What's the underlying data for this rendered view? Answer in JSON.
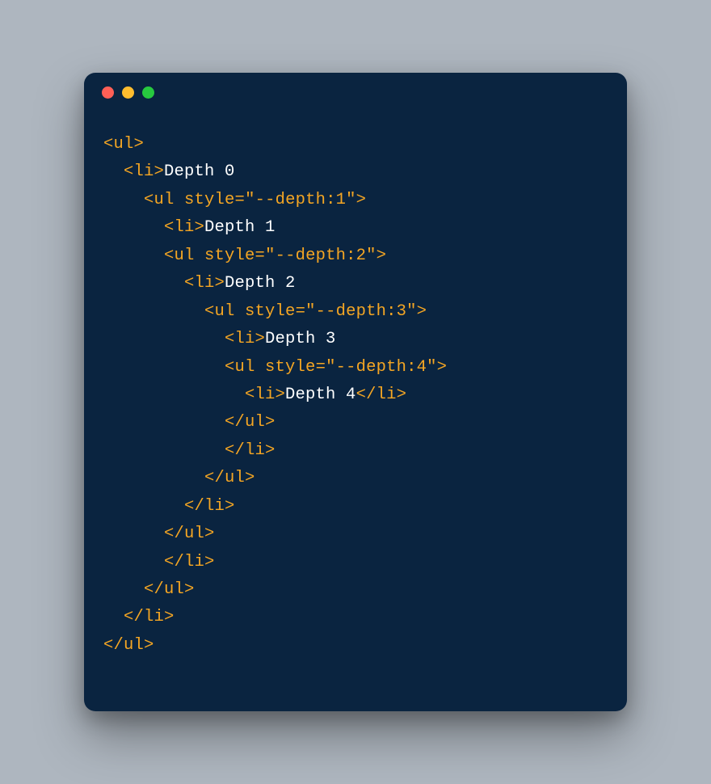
{
  "window": {
    "traffic_lights": {
      "close": "close",
      "minimize": "minimize",
      "maximize": "maximize"
    }
  },
  "code": {
    "lines": [
      {
        "indent": 0,
        "tokens": [
          {
            "c": "tag",
            "t": "<ul>"
          }
        ]
      },
      {
        "indent": 1,
        "tokens": [
          {
            "c": "tag",
            "t": "<li>"
          },
          {
            "c": "text",
            "t": "Depth 0"
          }
        ]
      },
      {
        "indent": 2,
        "tokens": [
          {
            "c": "tag",
            "t": "<ul "
          },
          {
            "c": "attr",
            "t": "style"
          },
          {
            "c": "tag",
            "t": "="
          },
          {
            "c": "str",
            "t": "\"--depth:1\""
          },
          {
            "c": "tag",
            "t": ">"
          }
        ]
      },
      {
        "indent": 3,
        "tokens": [
          {
            "c": "tag",
            "t": "<li>"
          },
          {
            "c": "text",
            "t": "Depth 1"
          }
        ]
      },
      {
        "indent": 3,
        "tokens": [
          {
            "c": "tag",
            "t": "<ul "
          },
          {
            "c": "attr",
            "t": "style"
          },
          {
            "c": "tag",
            "t": "="
          },
          {
            "c": "str",
            "t": "\"--depth:2\""
          },
          {
            "c": "tag",
            "t": ">"
          }
        ]
      },
      {
        "indent": 4,
        "tokens": [
          {
            "c": "tag",
            "t": "<li>"
          },
          {
            "c": "text",
            "t": "Depth 2"
          }
        ]
      },
      {
        "indent": 5,
        "tokens": [
          {
            "c": "tag",
            "t": "<ul "
          },
          {
            "c": "attr",
            "t": "style"
          },
          {
            "c": "tag",
            "t": "="
          },
          {
            "c": "str",
            "t": "\"--depth:3\""
          },
          {
            "c": "tag",
            "t": ">"
          }
        ]
      },
      {
        "indent": 6,
        "tokens": [
          {
            "c": "tag",
            "t": "<li>"
          },
          {
            "c": "text",
            "t": "Depth 3"
          }
        ]
      },
      {
        "indent": 6,
        "tokens": [
          {
            "c": "tag",
            "t": "<ul "
          },
          {
            "c": "attr",
            "t": "style"
          },
          {
            "c": "tag",
            "t": "="
          },
          {
            "c": "str",
            "t": "\"--depth:4\""
          },
          {
            "c": "tag",
            "t": ">"
          }
        ]
      },
      {
        "indent": 7,
        "tokens": [
          {
            "c": "tag",
            "t": "<li>"
          },
          {
            "c": "text",
            "t": "Depth 4"
          },
          {
            "c": "tag",
            "t": "</li>"
          }
        ]
      },
      {
        "indent": 6,
        "tokens": [
          {
            "c": "tag",
            "t": "</ul>"
          }
        ]
      },
      {
        "indent": 6,
        "tokens": [
          {
            "c": "tag",
            "t": "</li>"
          }
        ]
      },
      {
        "indent": 5,
        "tokens": [
          {
            "c": "tag",
            "t": "</ul>"
          }
        ]
      },
      {
        "indent": 4,
        "tokens": [
          {
            "c": "tag",
            "t": "</li>"
          }
        ]
      },
      {
        "indent": 3,
        "tokens": [
          {
            "c": "tag",
            "t": "</ul>"
          }
        ]
      },
      {
        "indent": 3,
        "tokens": [
          {
            "c": "tag",
            "t": "</li>"
          }
        ]
      },
      {
        "indent": 2,
        "tokens": [
          {
            "c": "tag",
            "t": "</ul>"
          }
        ]
      },
      {
        "indent": 1,
        "tokens": [
          {
            "c": "tag",
            "t": "</li>"
          }
        ]
      },
      {
        "indent": 0,
        "tokens": [
          {
            "c": "tag",
            "t": "</ul>"
          }
        ]
      }
    ]
  }
}
